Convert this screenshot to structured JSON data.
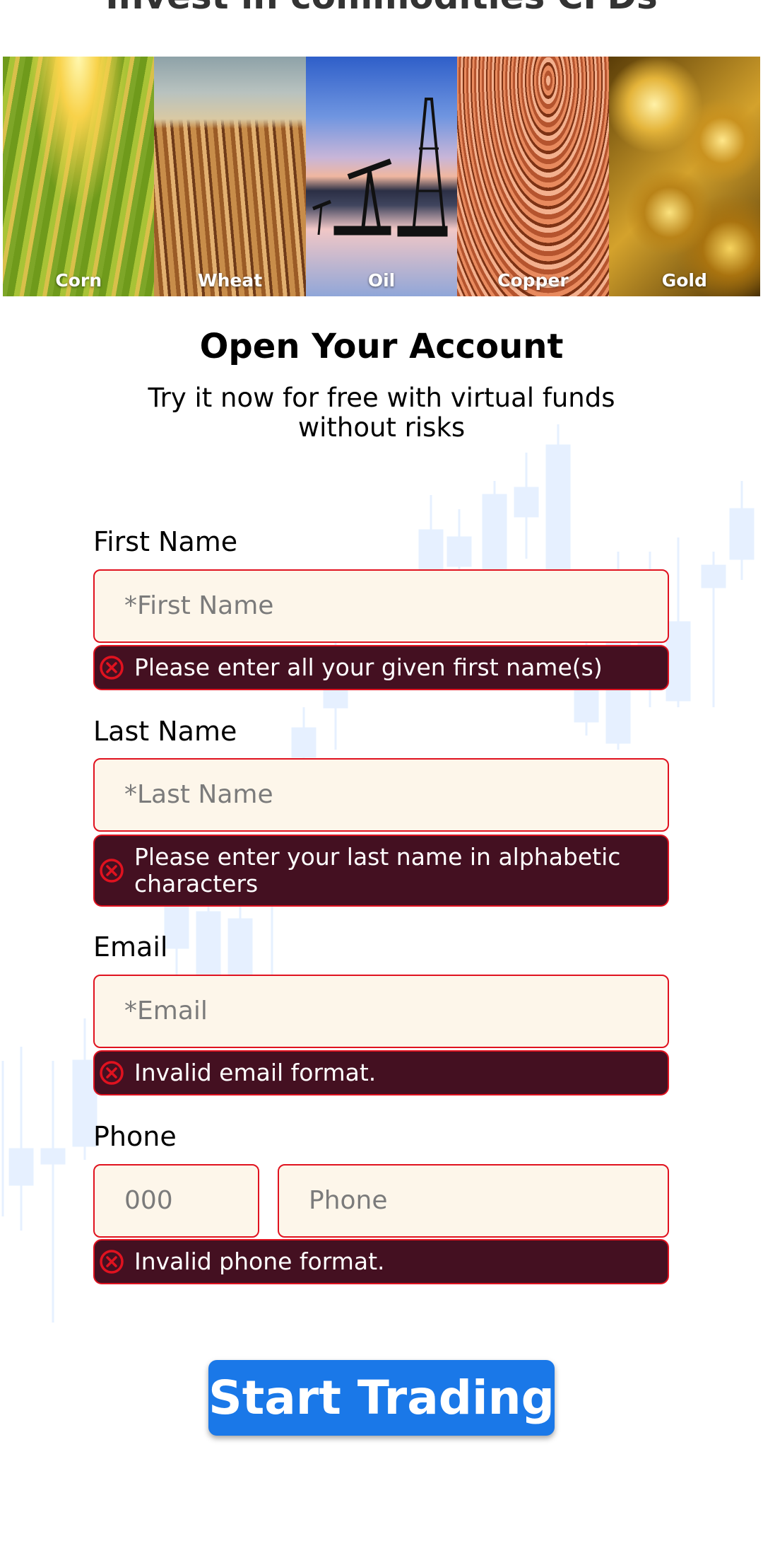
{
  "header": {
    "heading": "Invest in commodities CFDs"
  },
  "commodities": [
    {
      "label": "Corn"
    },
    {
      "label": "Wheat"
    },
    {
      "label": "Oil"
    },
    {
      "label": "Copper"
    },
    {
      "label": "Gold"
    }
  ],
  "form": {
    "title": "Open Your Account",
    "subtitle": "Try it now for free with virtual funds without risks",
    "first_name": {
      "label": "First Name",
      "placeholder": "*First Name",
      "value": "",
      "error": "Please enter all your given first name(s)"
    },
    "last_name": {
      "label": "Last Name",
      "placeholder": "*Last Name",
      "value": "",
      "error": "Please enter your last name in alphabetic characters"
    },
    "email": {
      "label": "Email",
      "placeholder": "*Email",
      "value": "",
      "error": "Invalid email format."
    },
    "phone": {
      "label": "Phone",
      "code_placeholder": "000",
      "placeholder": "Phone",
      "value": "",
      "error": "Invalid phone format."
    },
    "submit_label": "Start Trading"
  },
  "colors": {
    "accent": "#1a78e8",
    "error_border": "#e0121f",
    "error_background": "#441021",
    "input_background": "#fdf6ea",
    "background_chart": "#e6f0ff"
  }
}
